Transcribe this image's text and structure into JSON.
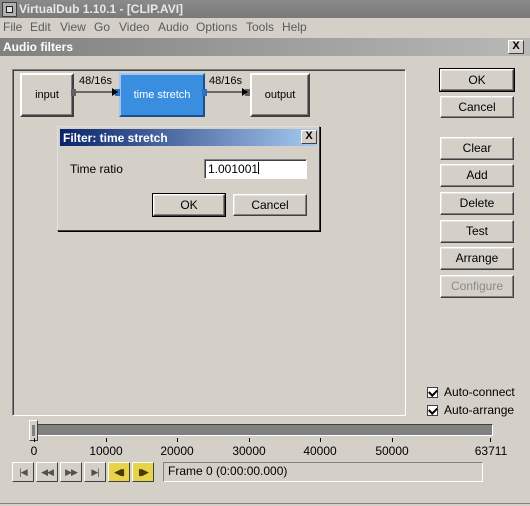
{
  "app": {
    "title": "VirtualDub 1.10.1 - [CLIP.AVI]"
  },
  "menu": [
    "File",
    "Edit",
    "View",
    "Go",
    "Video",
    "Audio",
    "Options",
    "Tools",
    "Help"
  ],
  "dialog": {
    "title": "Audio filters",
    "close": "X"
  },
  "graph": {
    "nodes": {
      "input": "input",
      "time_stretch": "time stretch",
      "output": "output"
    },
    "connections": [
      "48/16s",
      "48/16s"
    ]
  },
  "side_buttons": {
    "ok": "OK",
    "cancel": "Cancel",
    "clear": "Clear",
    "add": "Add",
    "delete": "Delete",
    "test": "Test",
    "arrange": "Arrange",
    "configure": "Configure"
  },
  "options": {
    "auto_connect": "Auto-connect",
    "auto_arrange": "Auto-arrange"
  },
  "subdialog": {
    "title": "Filter: time stretch",
    "close": "X",
    "field_label": "Time ratio",
    "field_value": "1.001001",
    "ok": "OK",
    "cancel": "Cancel"
  },
  "timeline": {
    "ticks": [
      "0",
      "10000",
      "20000",
      "30000",
      "40000",
      "50000",
      "63711"
    ],
    "frame_status": "Frame 0 (0:00:00.000)"
  },
  "transport": {
    "icons": [
      "stop-icon",
      "prev-frame-icon",
      "next-frame-icon",
      "end-icon",
      "prev-keyframe-icon",
      "next-keyframe-icon"
    ]
  },
  "colors": {
    "selected_node": "#3a8ee0",
    "subdialog_title": "#0a246a"
  }
}
